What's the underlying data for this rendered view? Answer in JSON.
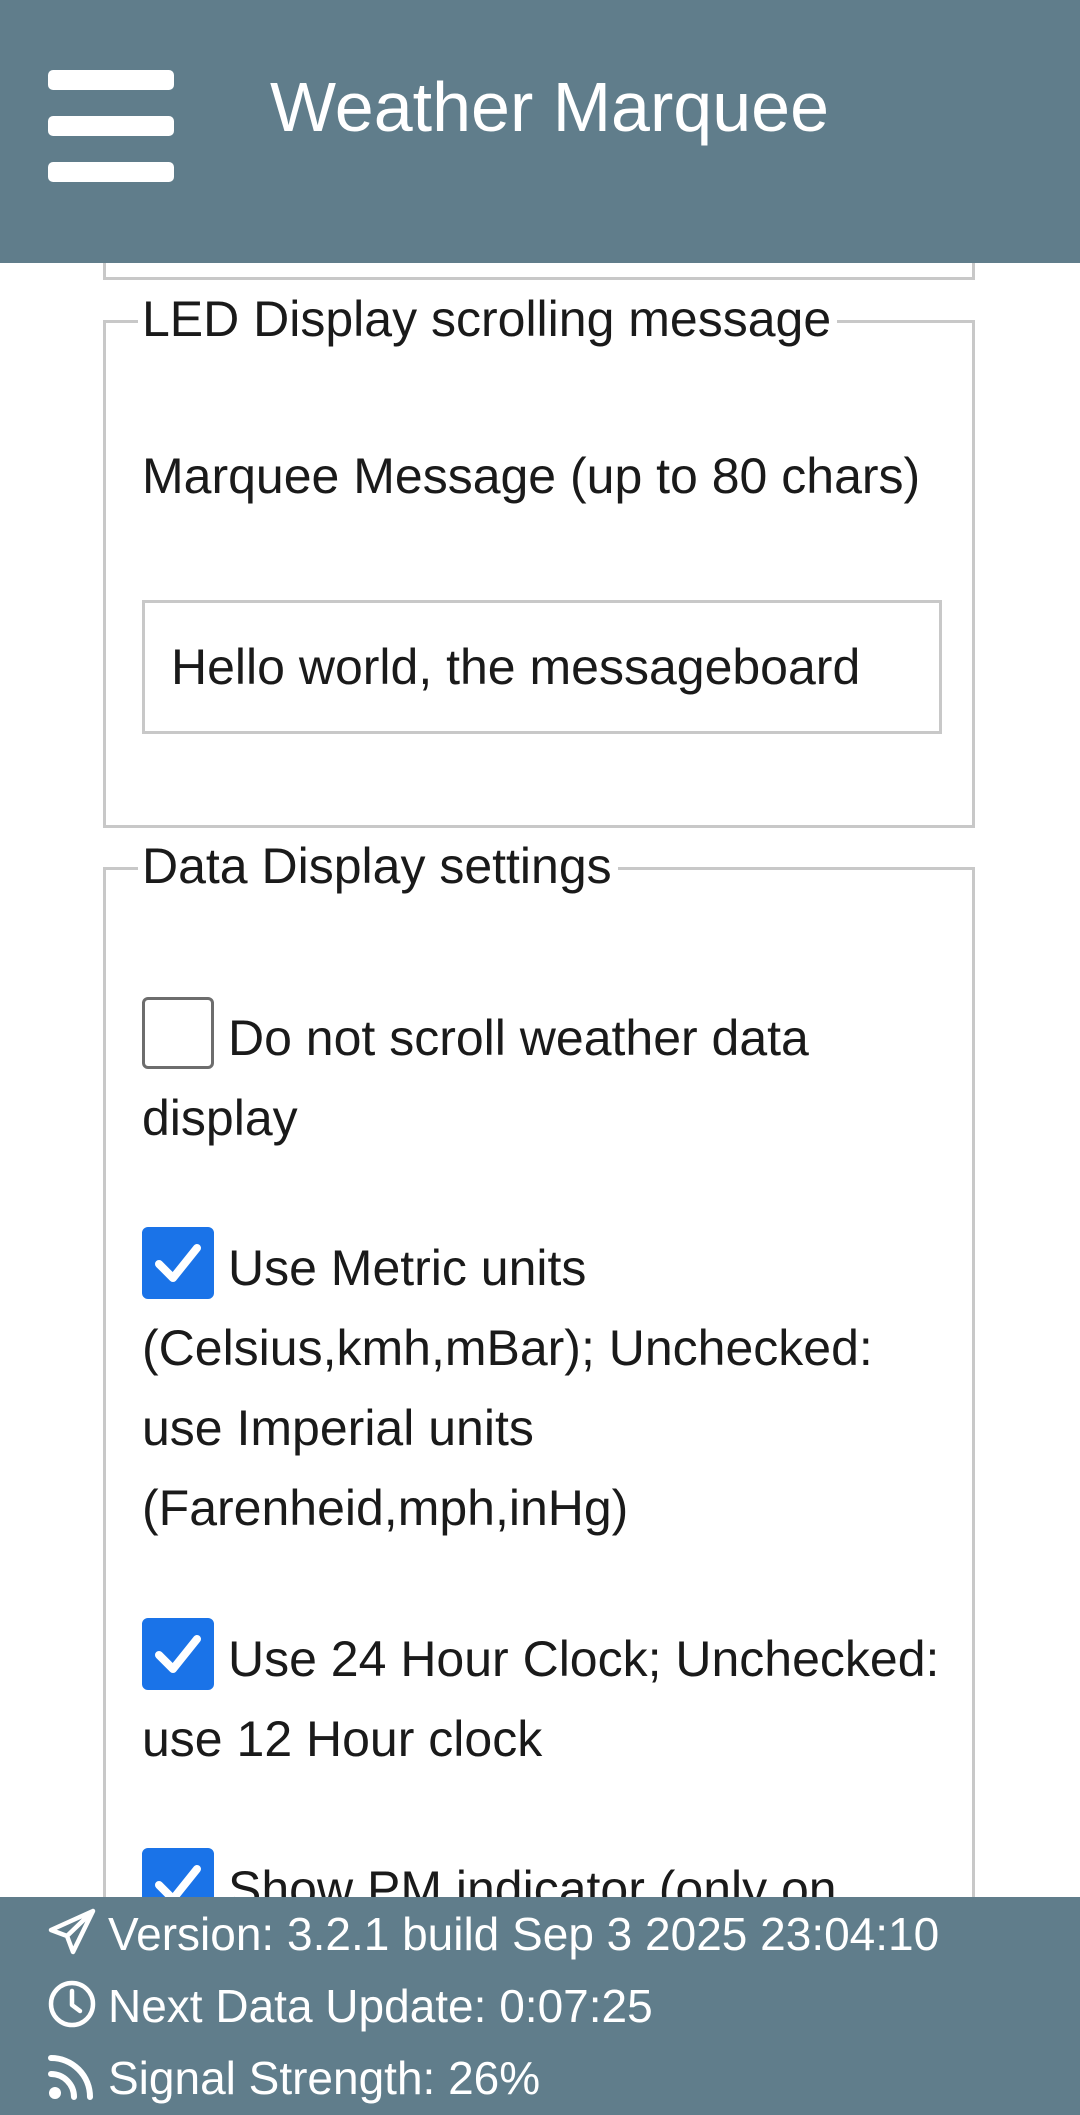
{
  "app": {
    "title": "Weather Marquee"
  },
  "icons": {
    "menu": "hamburger-menu-icon",
    "checkbox_checked": "checkmark-icon",
    "version": "paper-plane-icon",
    "next_update": "clock-icon",
    "signal": "rss-signal-icon"
  },
  "colors": {
    "header_bg": "#607d8b",
    "footer_bg": "#607d8b",
    "checkbox_checked": "#1a73e8",
    "border": "#c8c8c8"
  },
  "led_section": {
    "legend": "LED Display scrolling message",
    "message_label": "Marquee Message (up to 80 chars)",
    "message_value": "Hello world, the messageboard"
  },
  "data_section": {
    "legend": "Data Display settings",
    "options": [
      {
        "label": "Do not scroll weather data display",
        "checked": false
      },
      {
        "label": "Use Metric units (Celsius,kmh,mBar); Unchecked: use Imperial units (Farenheid,mph,inHg)",
        "checked": true
      },
      {
        "label": "Use 24 Hour Clock; Unchecked: use 12 Hour clock",
        "checked": true
      },
      {
        "label": "Show PM indicator (only on",
        "checked": true
      }
    ]
  },
  "footer": {
    "version": "Version: 3.2.1 build Sep 3 2025 23:04:10",
    "next_update": "Next Data Update: 0:07:25",
    "signal": "Signal Strength: 26%"
  }
}
